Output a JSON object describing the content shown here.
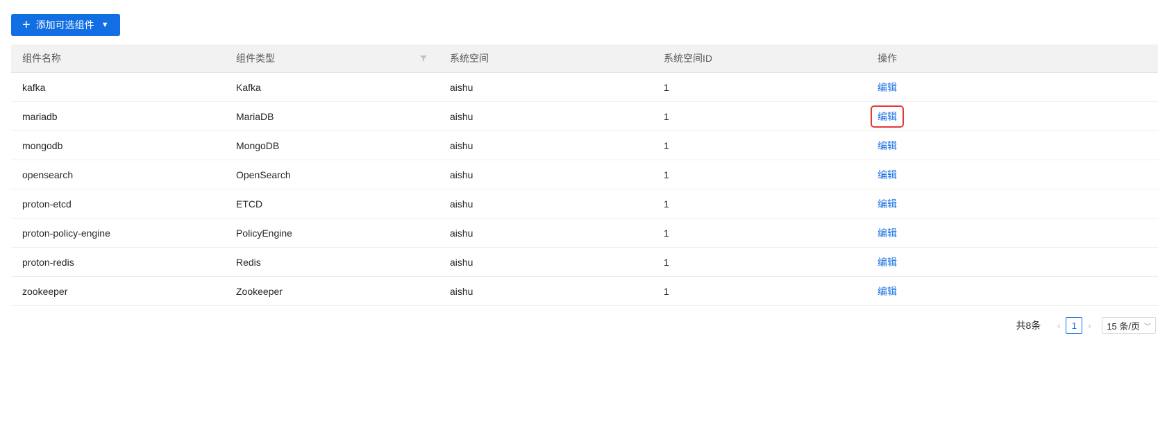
{
  "toolbar": {
    "add_label": "添加可选组件"
  },
  "table": {
    "columns": [
      "组件名称",
      "组件类型",
      "系统空间",
      "系统空间ID",
      "操作"
    ],
    "rows": [
      {
        "name": "kafka",
        "type": "Kafka",
        "space": "aishu",
        "space_id": "1",
        "action": "编辑"
      },
      {
        "name": "mariadb",
        "type": "MariaDB",
        "space": "aishu",
        "space_id": "1",
        "action": "编辑"
      },
      {
        "name": "mongodb",
        "type": "MongoDB",
        "space": "aishu",
        "space_id": "1",
        "action": "编辑"
      },
      {
        "name": "opensearch",
        "type": "OpenSearch",
        "space": "aishu",
        "space_id": "1",
        "action": "编辑"
      },
      {
        "name": "proton-etcd",
        "type": "ETCD",
        "space": "aishu",
        "space_id": "1",
        "action": "编辑"
      },
      {
        "name": "proton-policy-engine",
        "type": "PolicyEngine",
        "space": "aishu",
        "space_id": "1",
        "action": "编辑"
      },
      {
        "name": "proton-redis",
        "type": "Redis",
        "space": "aishu",
        "space_id": "1",
        "action": "编辑"
      },
      {
        "name": "zookeeper",
        "type": "Zookeeper",
        "space": "aishu",
        "space_id": "1",
        "action": "编辑"
      }
    ]
  },
  "pagination": {
    "total": "共8条",
    "current_page": "1",
    "page_size": "15 条/页"
  },
  "colors": {
    "primary": "#126ee3",
    "highlight": "#e53935"
  }
}
